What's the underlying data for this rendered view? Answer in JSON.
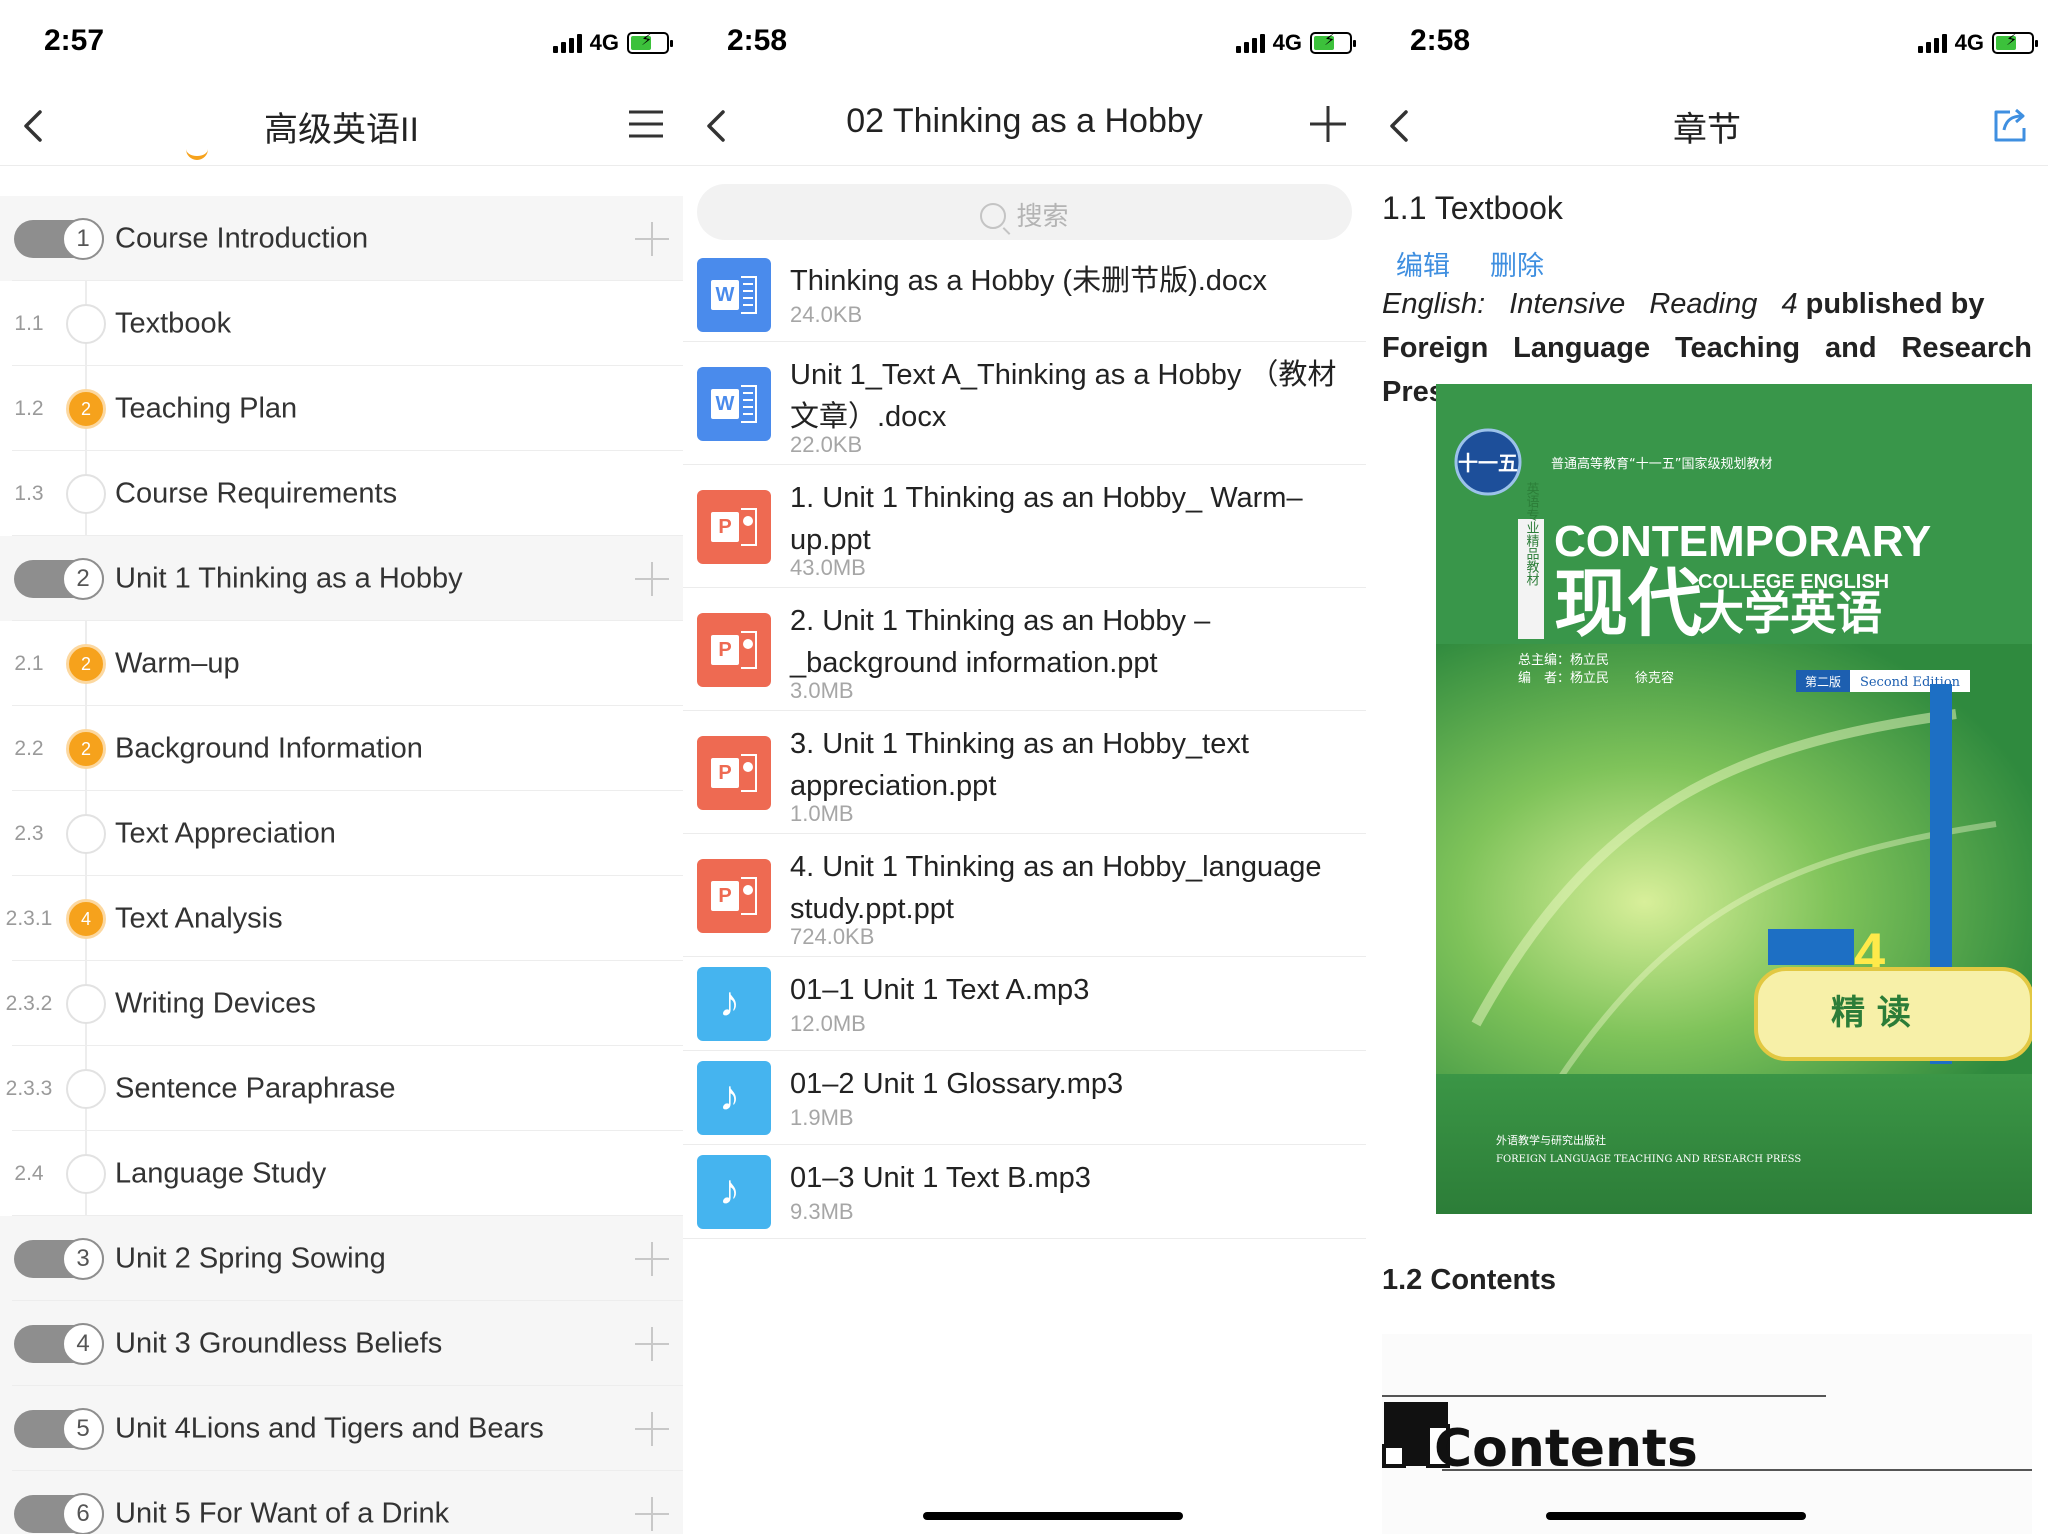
{
  "screen1": {
    "status": {
      "time": "2:57",
      "network": "4G"
    },
    "nav": {
      "title": "高级英语II"
    },
    "items": [
      {
        "type": "unit",
        "num": "1",
        "label": "Course Introduction"
      },
      {
        "type": "item",
        "num": "1.1",
        "label": "Textbook",
        "badge": ""
      },
      {
        "type": "item",
        "num": "1.2",
        "label": "Teaching Plan",
        "badge": "2"
      },
      {
        "type": "item",
        "num": "1.3",
        "label": "Course Requirements",
        "badge": ""
      },
      {
        "type": "unit",
        "num": "2",
        "label": "Unit 1 Thinking as a Hobby"
      },
      {
        "type": "item",
        "num": "2.1",
        "label": "Warm–up",
        "badge": "2"
      },
      {
        "type": "item",
        "num": "2.2",
        "label": "Background Information",
        "badge": "2"
      },
      {
        "type": "item",
        "num": "2.3",
        "label": "Text Appreciation",
        "badge": ""
      },
      {
        "type": "item",
        "num": "2.3.1",
        "label": "Text Analysis",
        "badge": "4"
      },
      {
        "type": "item",
        "num": "2.3.2",
        "label": "Writing Devices",
        "badge": ""
      },
      {
        "type": "item",
        "num": "2.3.3",
        "label": "Sentence Paraphrase",
        "badge": ""
      },
      {
        "type": "item",
        "num": "2.4",
        "label": "Language Study",
        "badge": ""
      },
      {
        "type": "unit",
        "num": "3",
        "label": "Unit 2 Spring Sowing"
      },
      {
        "type": "unit",
        "num": "4",
        "label": "Unit 3 Groundless Beliefs"
      },
      {
        "type": "unit",
        "num": "5",
        "label": "Unit 4Lions and Tigers and Bears"
      },
      {
        "type": "unit",
        "num": "6",
        "label": "Unit 5 For Want of a Drink"
      }
    ]
  },
  "screen2": {
    "status": {
      "time": "2:58",
      "network": "4G"
    },
    "nav": {
      "title": "02 Thinking as a Hobby"
    },
    "search": {
      "placeholder": "搜索"
    },
    "files": [
      {
        "kind": "word",
        "name": "Thinking as a Hobby (未删节版).docx",
        "size": "24.0KB"
      },
      {
        "kind": "word",
        "name": "Unit 1_Text A_Thinking as a Hobby （教材文章）.docx",
        "size": "22.0KB"
      },
      {
        "kind": "ppt",
        "name": "1. Unit 1 Thinking as an Hobby_ Warm–up.ppt",
        "size": "43.0MB"
      },
      {
        "kind": "ppt",
        "name": "2. Unit 1 Thinking as an Hobby –_background information.ppt",
        "size": "3.0MB"
      },
      {
        "kind": "ppt",
        "name": "3. Unit 1 Thinking as an Hobby_text appreciation.ppt",
        "size": "1.0MB"
      },
      {
        "kind": "ppt",
        "name": "4. Unit 1 Thinking as an Hobby_language study.ppt.ppt",
        "size": "724.0KB"
      },
      {
        "kind": "audio",
        "name": "01–1 Unit 1 Text A.mp3",
        "size": "12.0MB"
      },
      {
        "kind": "audio",
        "name": "01–2 Unit 1 Glossary.mp3",
        "size": "1.9MB"
      },
      {
        "kind": "audio",
        "name": "01–3 Unit 1 Text B.mp3",
        "size": "9.3MB"
      }
    ]
  },
  "screen3": {
    "status": {
      "time": "2:58",
      "network": "4G"
    },
    "nav": {
      "title": "章节"
    },
    "section_title": "1.1 Textbook",
    "edit_label": "编辑",
    "delete_label": "删除",
    "desc_italic": "English: Intensive Reading 4",
    "desc_bold_1": "published by",
    "desc_bold_2": "Foreign Language Teaching and Research Press",
    "book": {
      "series": "普通高等教育“十一五”国家级规划教材",
      "badge": "十一五",
      "side_label": "英语专业精品教材",
      "title_en": "CONTEMPORARY",
      "title_en_sub": "COLLEGE ENGLISH",
      "title_cn_1": "现代",
      "title_cn_2": "大学英语",
      "chief_editor": "总主编：杨立民",
      "editors": "编　者：杨立民　　徐克容",
      "edition_cn": "第二版",
      "edition_en": "Second Edition",
      "volume": "4",
      "volume_label": "精 读",
      "publisher_cn": "外语教学与研究出版社",
      "publisher_en": "FOREIGN LANGUAGE TEACHING AND RESEARCH PRESS"
    },
    "subsection_title": "1.2 Contents",
    "contents_heading": "Contents"
  }
}
